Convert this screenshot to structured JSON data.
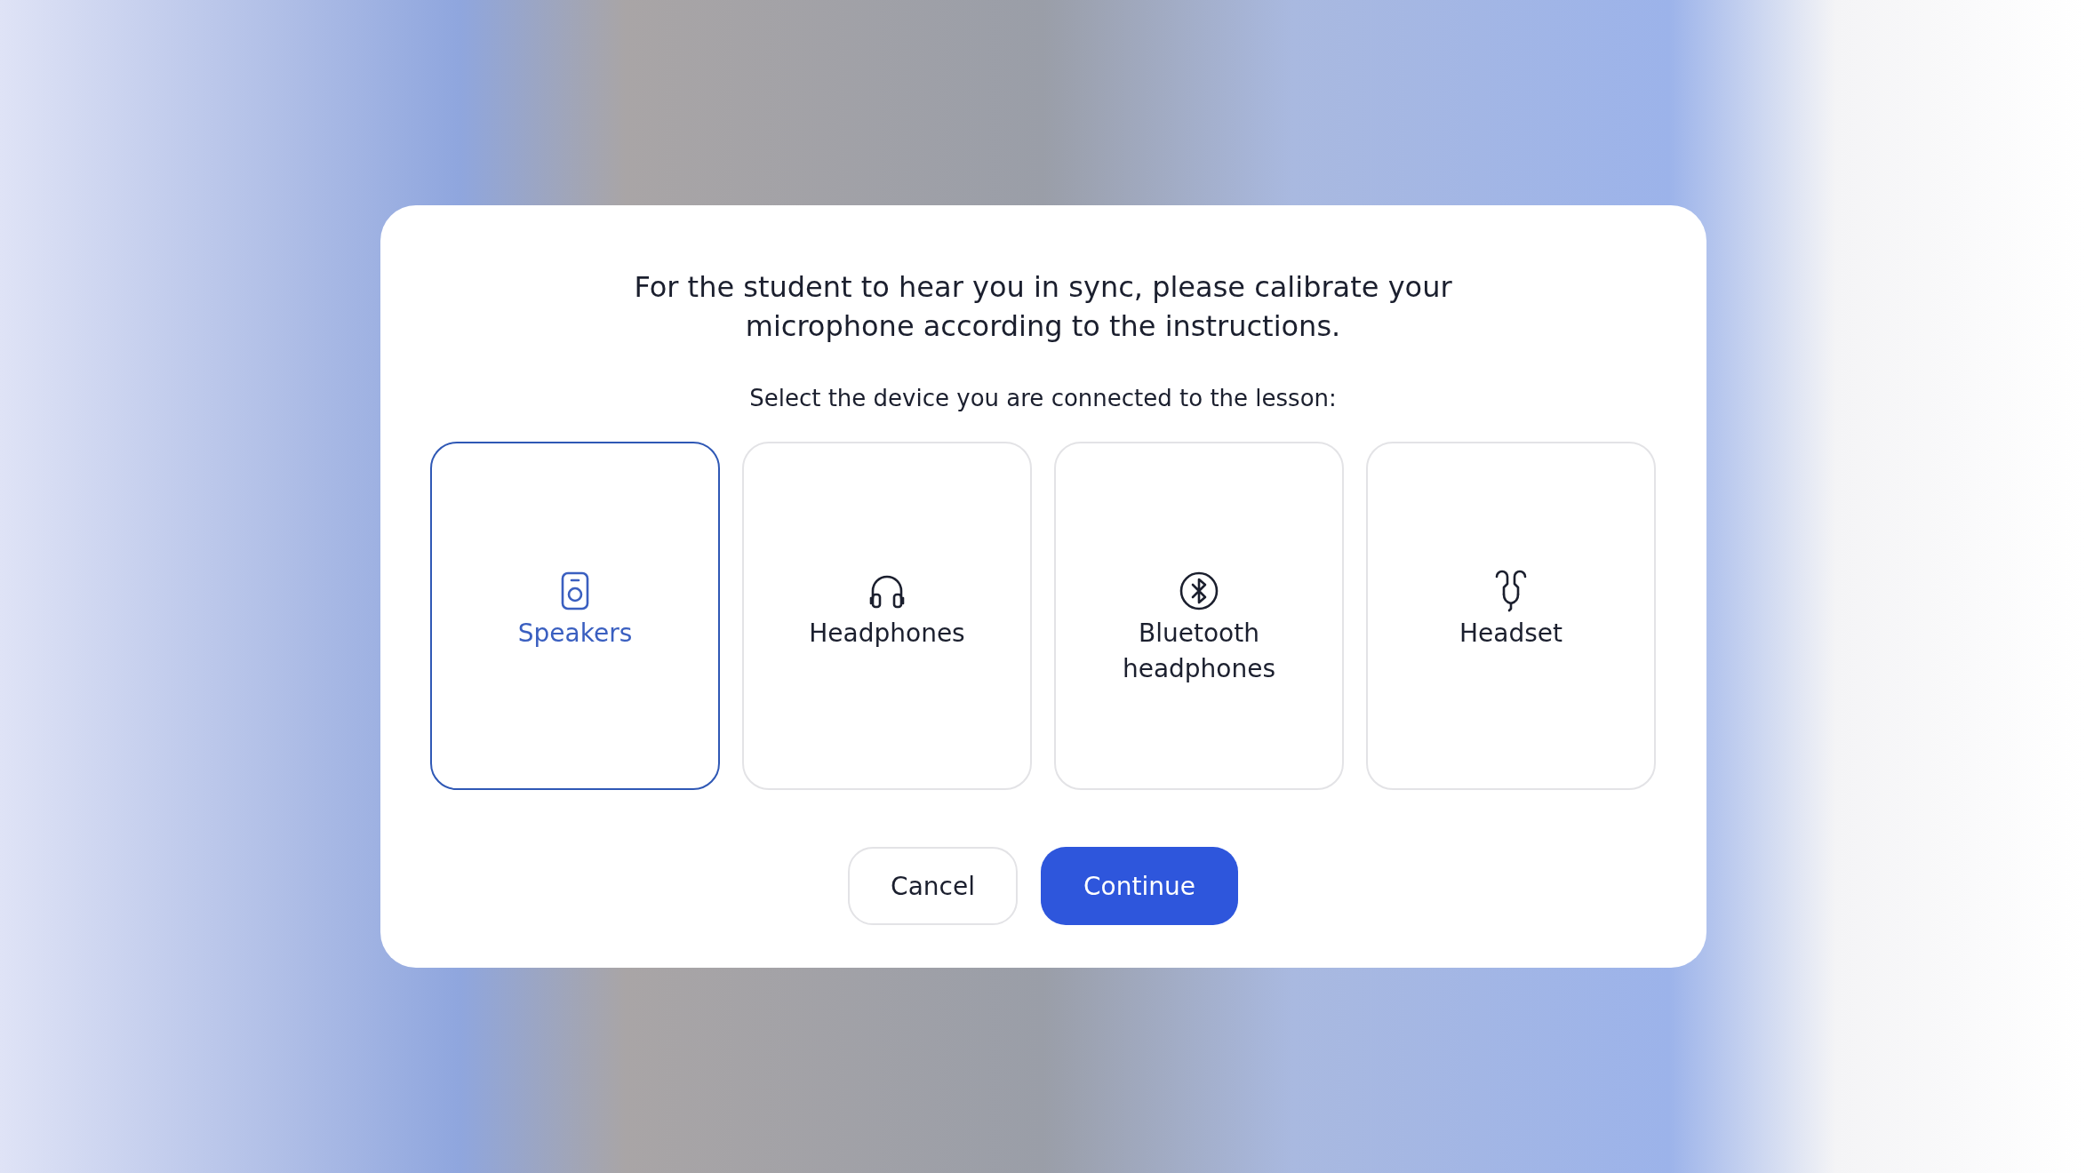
{
  "dialog": {
    "title": "For the student to hear you in sync, please calibrate your microphone according to the instructions.",
    "prompt": "Select the device you are connected to the lesson:",
    "devices": [
      {
        "kind": "speaker",
        "label": "Speakers",
        "selected": true
      },
      {
        "kind": "headphones",
        "label": "Headphones",
        "selected": false
      },
      {
        "kind": "bluetooth",
        "label": "Bluetooth headphones",
        "selected": false
      },
      {
        "kind": "headset",
        "label": "Headset",
        "selected": false
      }
    ],
    "buttons": [
      {
        "kind": "secondary",
        "label": "Cancel"
      },
      {
        "kind": "primary",
        "label": "Continue"
      }
    ]
  }
}
